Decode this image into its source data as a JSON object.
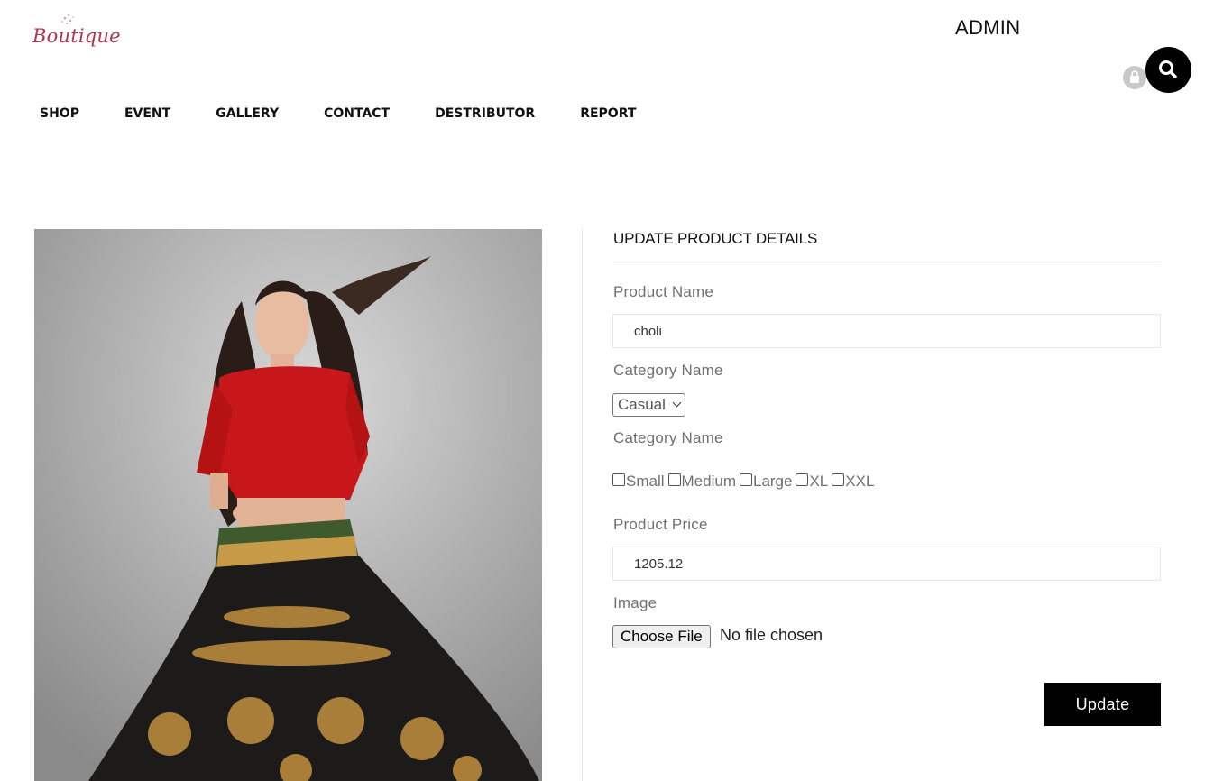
{
  "header": {
    "logo_text": "Boutique",
    "user_label": "ADMIN"
  },
  "nav": [
    {
      "label": "SHOP"
    },
    {
      "label": "EVENT"
    },
    {
      "label": "GALLERY"
    },
    {
      "label": "CONTACT"
    },
    {
      "label": "DESTRIBUTOR"
    },
    {
      "label": "REPORT"
    }
  ],
  "icons": {
    "search": "search-icon",
    "lock": "lock-icon"
  },
  "form": {
    "heading": "UPDATE PRODUCT DETAILS",
    "product_name_label": "Product Name",
    "product_name_value": "choli",
    "category_label": "Category Name",
    "category_selected": "Casual",
    "size_label": "Category Name",
    "sizes": [
      {
        "label": "Small",
        "checked": false
      },
      {
        "label": "Medium",
        "checked": false
      },
      {
        "label": "Large",
        "checked": false
      },
      {
        "label": "XL",
        "checked": false
      },
      {
        "label": "XXL",
        "checked": false
      }
    ],
    "price_label": "Product Price",
    "price_value": "1205.12",
    "image_label": "Image",
    "choose_file_label": "Choose File",
    "no_file_text": "No file chosen",
    "submit_label": "Update"
  },
  "colors": {
    "brand": "#b3344e",
    "button": "#000000",
    "label": "#707070"
  }
}
